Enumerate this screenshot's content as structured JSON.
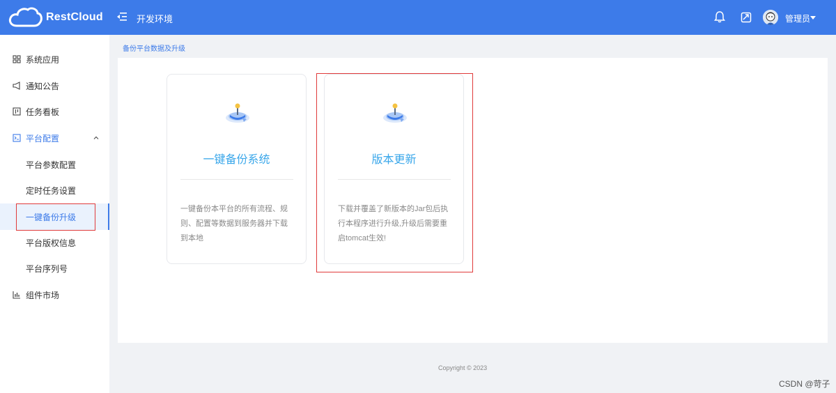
{
  "header": {
    "brand": "RestCloud",
    "env_title": "开发环境",
    "user_name": "管理员"
  },
  "sidebar": {
    "items": [
      {
        "label": "系统应用",
        "icon": "grid-icon"
      },
      {
        "label": "通知公告",
        "icon": "megaphone-icon"
      },
      {
        "label": "任务看板",
        "icon": "kanban-icon"
      },
      {
        "label": "平台配置",
        "icon": "terminal-icon"
      },
      {
        "label": "组件市场",
        "icon": "bar-chart-icon"
      }
    ],
    "sub_items": [
      {
        "label": "平台参数配置"
      },
      {
        "label": "定时任务设置"
      },
      {
        "label": "一键备份升级"
      },
      {
        "label": "平台版权信息"
      },
      {
        "label": "平台序列号"
      }
    ]
  },
  "breadcrumb": "备份平台数据及升级",
  "cards": [
    {
      "title": "一键备份系统",
      "desc": "一键备份本平台的所有流程、规则、配置等数据到服务器并下载到本地"
    },
    {
      "title": "版本更新",
      "desc": "下载并覆盖了新版本的Jar包后执行本程序进行升级,升级后需要重启tomcat生效!"
    }
  ],
  "footer": "Copyright © 2023",
  "watermark": "CSDN @苛子",
  "colors": {
    "brand_blue": "#3d7be9",
    "title_blue": "#3aa7ea",
    "highlight_red": "#e03a3a"
  }
}
